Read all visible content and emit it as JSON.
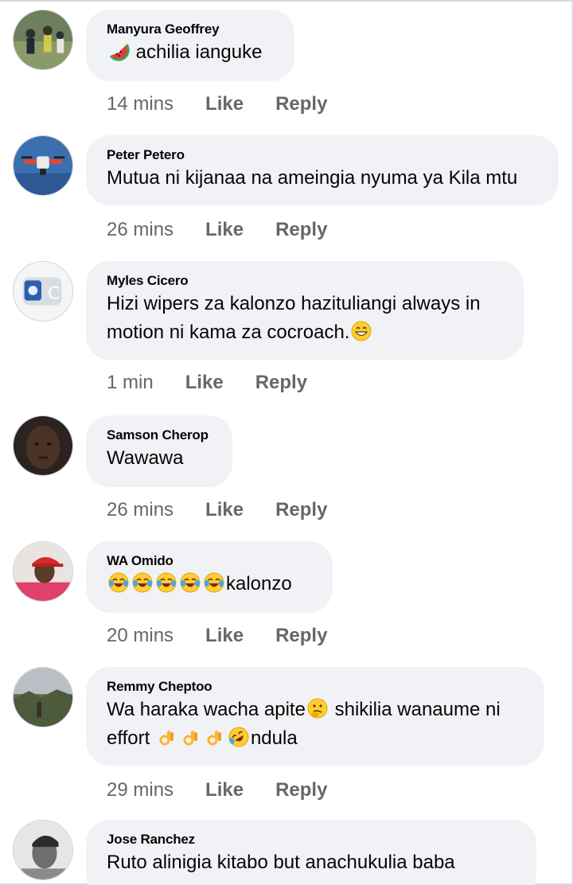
{
  "comments": [
    {
      "author": "Manyura Geoffrey",
      "lines": [
        "achilia ianguke"
      ],
      "time": "14 mins",
      "avatar_icon": "crowd-photo-avatar",
      "emoji": [
        "watermelon"
      ]
    },
    {
      "author": "Peter Petero",
      "lines": [
        "Mutua ni kijanaa na ameingia nyuma ya Kila mtu"
      ],
      "time": "26 mins",
      "avatar_icon": "drone-avatar"
    },
    {
      "author": "Myles Cicero",
      "lines": [
        "Hizi wipers za kalonzo hazituliangi always in",
        "motion ni kama za cocroach."
      ],
      "time": "1 min",
      "avatar_icon": "logo-avatar",
      "emoji": [
        "grinning-face"
      ]
    },
    {
      "author": "Samson Cherop",
      "lines": [
        "Wawawa"
      ],
      "time": "26 mins",
      "avatar_icon": "face-avatar"
    },
    {
      "author": "WA Omido",
      "lines": [
        "kalonzo"
      ],
      "time": "20 mins",
      "avatar_icon": "red-cap-avatar",
      "emoji": [
        "tears-of-joy",
        "tears-of-joy",
        "tears-of-joy",
        "tears-of-joy",
        "tears-of-joy"
      ]
    },
    {
      "author": "Remmy Cheptoo",
      "lines": [
        "Wa haraka  wacha apite",
        " shikilia wanaume ni",
        "effort ",
        "ndula"
      ],
      "time": "29 mins",
      "avatar_icon": "outdoor-avatar",
      "emoji": [
        "thinking-face",
        "ok-hand",
        "ok-hand",
        "ok-hand",
        "rofl-face"
      ]
    },
    {
      "author": "Jose Ranchez",
      "lines": [
        "Ruto alinigia kitabo but anachukulia baba"
      ],
      "avatar_icon": "bw-portrait-avatar"
    }
  ],
  "labels": {
    "like": "Like",
    "reply": "Reply"
  },
  "colors": {
    "bubble": "#f0f2f5",
    "meta": "#65676b",
    "text": "#050505"
  }
}
